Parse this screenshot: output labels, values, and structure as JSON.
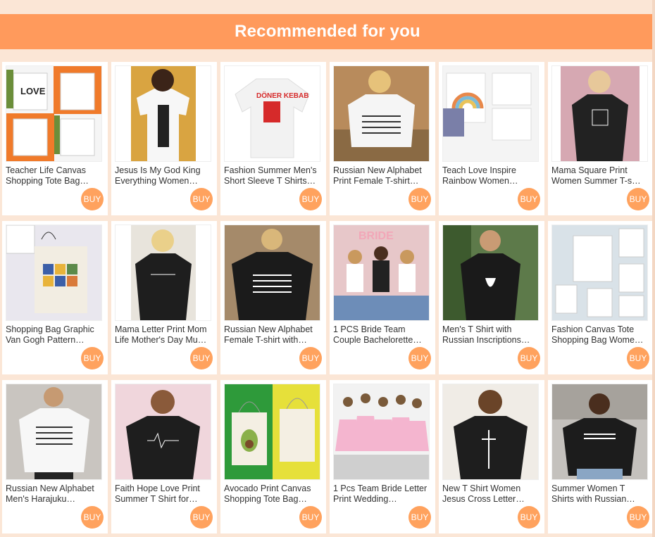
{
  "header": {
    "title": "Recommended for you"
  },
  "products": [
    {
      "title": "Teacher Life Canvas Shopping Tote Bag…",
      "buy_label": "BUY",
      "art": "tote-collage"
    },
    {
      "title": "Jesus Is My God King Everything Women…",
      "buy_label": "BUY",
      "art": "white-tee-person"
    },
    {
      "title": "Fashion Summer Men's Short Sleeve T Shirts…",
      "buy_label": "BUY",
      "art": "white-tee-red-print"
    },
    {
      "title": "Russian New Alphabet Print Female T-shirt…",
      "buy_label": "BUY",
      "art": "white-tee-outdoor"
    },
    {
      "title": "Teach Love Inspire Rainbow Women…",
      "buy_label": "BUY",
      "art": "rainbow-bags"
    },
    {
      "title": "Mama Square Print Women Summer T-s…",
      "buy_label": "BUY",
      "art": "black-tee-pink"
    },
    {
      "title": "Shopping Bag Graphic Van Gogh Pattern…",
      "buy_label": "BUY",
      "art": "tote-vangogh"
    },
    {
      "title": "Mama Letter Print Mom Life Mother's Day Mu…",
      "buy_label": "BUY",
      "art": "black-tee-person"
    },
    {
      "title": "Russian New Alphabet Female T-shirt with…",
      "buy_label": "BUY",
      "art": "black-tee-alphabet"
    },
    {
      "title": "1 PCS Bride Team Couple Bachelorette…",
      "buy_label": "BUY",
      "art": "bride-group"
    },
    {
      "title": "Men's T Shirt with Russian Inscriptions…",
      "buy_label": "BUY",
      "art": "black-tee-man"
    },
    {
      "title": "Fashion Canvas Tote Shopping Bag Wome…",
      "buy_label": "BUY",
      "art": "tote-quotes"
    },
    {
      "title": "Russian New Alphabet Men's Harajuku…",
      "buy_label": "BUY",
      "art": "white-tee-man"
    },
    {
      "title": "Faith Hope Love Print Summer T Shirt for…",
      "buy_label": "BUY",
      "art": "black-tee-smile"
    },
    {
      "title": "Avocado Print Canvas Shopping Tote Bag…",
      "buy_label": "BUY",
      "art": "avocado-totes"
    },
    {
      "title": "1 Pcs Team Bride Letter Print Wedding…",
      "buy_label": "BUY",
      "art": "bride-pink"
    },
    {
      "title": "New T Shirt Women Jesus Cross Letter…",
      "buy_label": "BUY",
      "art": "black-tee-cross"
    },
    {
      "title": "Summer Women T Shirts with Russian…",
      "buy_label": "BUY",
      "art": "black-tee-street"
    }
  ],
  "colors": {
    "page_bg": "#fbe6d6",
    "banner": "#ff9a5c",
    "buy_button": "#ffa25e"
  }
}
